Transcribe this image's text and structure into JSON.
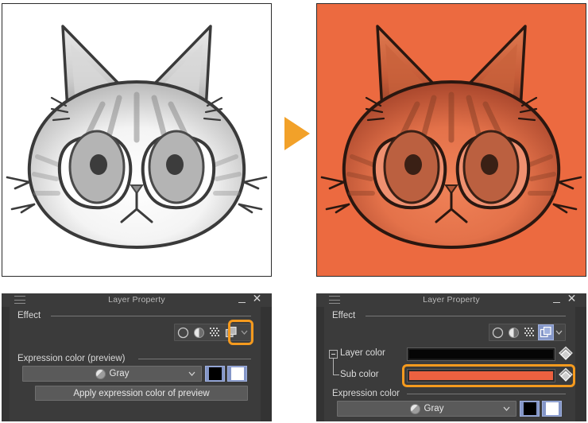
{
  "images": {
    "before": {
      "name": "grayscale-cat-sketch",
      "background": "#ffffff",
      "description": "Grayscale sketch of a cat face with pointed ears, large eyes and whiskers"
    },
    "after": {
      "name": "orange-recolored-cat-sketch",
      "background": "#ec6a40",
      "description": "Same cat sketch recolored with orange layer color"
    },
    "arrow": {
      "icon": "triangle-right-icon",
      "color": "#f2a129"
    }
  },
  "panel_left": {
    "titlebar": {
      "menu_icon": "hamburger-icon",
      "title": "Layer Property",
      "minimize_icon": "minimize-icon",
      "close_icon": "close-icon"
    },
    "effect_group": {
      "label": "Effect",
      "icons": [
        {
          "name": "border-effect-icon",
          "glyph": "circle-outline",
          "selected": false
        },
        {
          "name": "tone-effect-icon",
          "glyph": "half-tone-circle",
          "selected": false
        },
        {
          "name": "halftone-effect-icon",
          "glyph": "dot-grid",
          "selected": false
        },
        {
          "name": "layer-color-effect-icon",
          "glyph": "two-squares",
          "selected": true
        }
      ],
      "chevron_icon": "chevron-down-icon",
      "highlight_color": "#f59a1e"
    },
    "expression_group": {
      "label": "Expression color (preview)",
      "dropdown": {
        "icon": "gray-sphere-icon",
        "value": "Gray",
        "chevron_icon": "chevron-down-icon"
      },
      "swatches": [
        {
          "name": "main-color-swatch",
          "color": "#000000"
        },
        {
          "name": "sub-color-swatch",
          "color": "#ffffff"
        }
      ],
      "apply_button": "Apply expression color of preview"
    }
  },
  "panel_right": {
    "titlebar": {
      "menu_icon": "hamburger-icon",
      "title": "Layer Property",
      "minimize_icon": "minimize-icon",
      "close_icon": "close-icon"
    },
    "effect_group": {
      "label": "Effect",
      "icons": [
        {
          "name": "border-effect-icon",
          "glyph": "circle-outline",
          "selected": false
        },
        {
          "name": "tone-effect-icon",
          "glyph": "half-tone-circle",
          "selected": false
        },
        {
          "name": "halftone-effect-icon",
          "glyph": "dot-grid",
          "selected": false
        },
        {
          "name": "layer-color-effect-icon",
          "glyph": "two-squares",
          "selected": true
        }
      ],
      "chevron_icon": "chevron-down-icon",
      "selected_color": "#8496c8"
    },
    "layer_color": {
      "expander_icon": "tree-collapse-icon",
      "label": "Layer color",
      "color": "#050505",
      "picker_icon": "color-picker-diamond-icon"
    },
    "sub_color": {
      "label": "Sub color",
      "color": "#ec6140",
      "picker_icon": "color-picker-diamond-icon",
      "highlight_color": "#f59a1e"
    },
    "expression_group": {
      "label": "Expression color",
      "dropdown": {
        "icon": "gray-sphere-icon",
        "value": "Gray",
        "chevron_icon": "chevron-down-icon"
      },
      "swatches": [
        {
          "name": "main-color-swatch",
          "color": "#000000"
        },
        {
          "name": "sub-color-swatch",
          "color": "#ffffff"
        }
      ]
    }
  }
}
